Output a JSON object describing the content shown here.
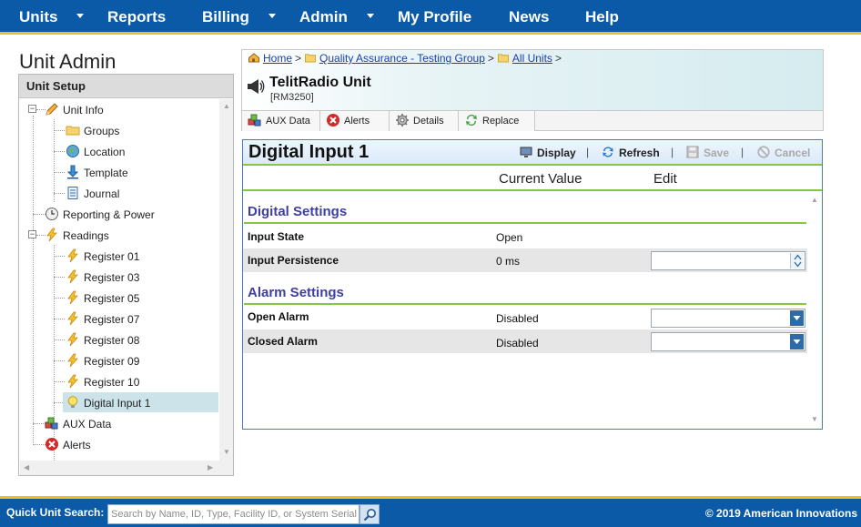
{
  "nav": {
    "items": [
      {
        "label": "Units",
        "has_dropdown": true
      },
      {
        "label": "Reports",
        "has_dropdown": false
      },
      {
        "label": "Billing",
        "has_dropdown": true
      },
      {
        "label": "Admin",
        "has_dropdown": true
      },
      {
        "label": "My Profile",
        "has_dropdown": false
      },
      {
        "label": "News",
        "has_dropdown": false
      },
      {
        "label": "Help",
        "has_dropdown": false
      }
    ]
  },
  "left": {
    "title": "Unit Admin",
    "header": "Unit Setup",
    "tree": [
      {
        "label": "Unit Info",
        "icon": "pencil-icon",
        "expanded": true
      },
      {
        "label": "Groups",
        "icon": "folder-icon"
      },
      {
        "label": "Location",
        "icon": "globe-icon"
      },
      {
        "label": "Template",
        "icon": "download-arrow-icon"
      },
      {
        "label": "Journal",
        "icon": "notebook-icon"
      },
      {
        "label": "Reporting & Power",
        "icon": "clock-icon"
      },
      {
        "label": "Readings",
        "icon": "lightning-icon",
        "expanded": true
      },
      {
        "label": "Register 01",
        "icon": "lightning-icon"
      },
      {
        "label": "Register 03",
        "icon": "lightning-icon"
      },
      {
        "label": "Register 05",
        "icon": "lightning-icon"
      },
      {
        "label": "Register 07",
        "icon": "lightning-icon"
      },
      {
        "label": "Register 08",
        "icon": "lightning-icon"
      },
      {
        "label": "Register 09",
        "icon": "lightning-icon"
      },
      {
        "label": "Register 10",
        "icon": "lightning-icon"
      },
      {
        "label": "Digital Input 1",
        "icon": "lightbulb-icon",
        "selected": true
      },
      {
        "label": "AUX Data",
        "icon": "cubes-icon"
      },
      {
        "label": "Alerts",
        "icon": "error-x-icon"
      }
    ]
  },
  "header": {
    "breadcrumb": {
      "home": "Home",
      "group": "Quality Assurance - Testing Group",
      "all_units": "All Units",
      "sep": ">"
    },
    "unit_name": "TelitRadio Unit",
    "unit_serial": "[RM3250]"
  },
  "tabs": [
    {
      "label": "AUX Data",
      "icon": "cubes-icon"
    },
    {
      "label": "Alerts",
      "icon": "error-x-icon"
    },
    {
      "label": "Details",
      "icon": "gear-icon"
    },
    {
      "label": "Replace",
      "icon": "refresh-arrows-icon"
    }
  ],
  "main": {
    "title": "Digital Input 1",
    "toolbar": {
      "display": "Display",
      "refresh": "Refresh",
      "save": "Save",
      "cancel": "Cancel",
      "sep": "|"
    },
    "columns": {
      "current_value": "Current Value",
      "edit": "Edit"
    },
    "sections": [
      {
        "title": "Digital Settings",
        "rows": [
          {
            "name": "Input State",
            "value": "Open",
            "editor": "none"
          },
          {
            "name": "Input Persistence",
            "value": "0 ms",
            "editor": "spinner"
          }
        ]
      },
      {
        "title": "Alarm Settings",
        "rows": [
          {
            "name": "Open Alarm",
            "value": "Disabled",
            "editor": "dropdown"
          },
          {
            "name": "Closed Alarm",
            "value": "Disabled",
            "editor": "dropdown"
          }
        ]
      }
    ]
  },
  "footer": {
    "quick_search_label": "Quick Unit Search:",
    "quick_search_placeholder": "Search by Name, ID, Type, Facility ID, or System Serial",
    "copyright": "© 2019 American Innovations"
  },
  "colors": {
    "nav_bg": "#0b5aa7",
    "accent_yellow": "#e6c12a",
    "section_title": "#3f3fa0",
    "green_rule": "#86c640",
    "link": "#1a3fb0",
    "selected_tree_bg": "#cde3ea"
  }
}
